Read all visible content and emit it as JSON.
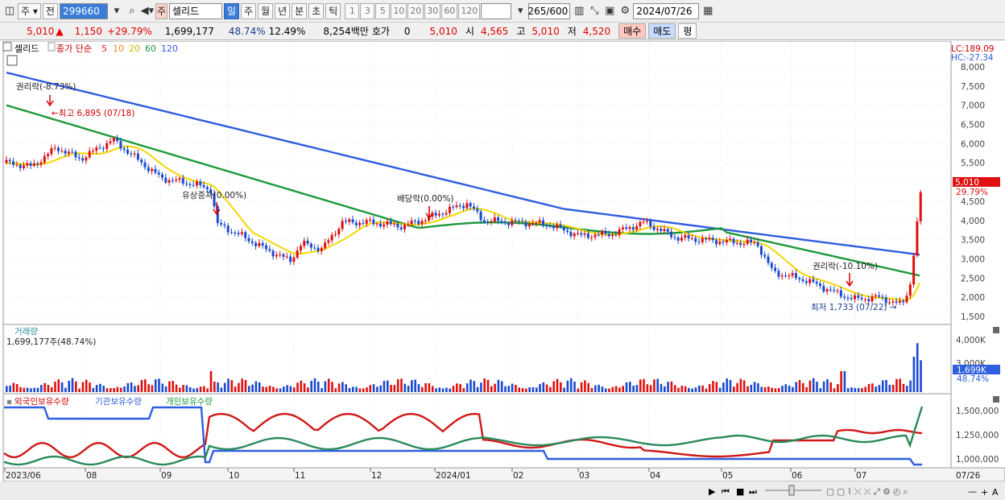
{
  "toolbar": {
    "type1": "주",
    "type2": "전",
    "code": "299660",
    "kind": "주",
    "name": "셀리드",
    "periods": [
      "일",
      "주",
      "월",
      "년",
      "분",
      "초",
      "틱"
    ],
    "selected_period": "일",
    "ticks": [
      "1",
      "3",
      "5",
      "10",
      "20",
      "30",
      "60",
      "120"
    ],
    "count": "265",
    "count_max": "/600",
    "date": "2024/07/26"
  },
  "quote": {
    "price": "5,010",
    "arrow": "▲",
    "change": "1,150",
    "rate": "+29.79%",
    "volume": "1,699,177",
    "vol_ratio": "48.74%",
    "turnover": "12.49%",
    "amount": "8,254백만",
    "hoga_label": "호가",
    "hoga_value": "0",
    "hoga_price": "5,010",
    "open_label": "시",
    "open": "4,565",
    "high_label": "고",
    "high": "5,010",
    "low_label": "저",
    "low": "4,520",
    "buy": "매수",
    "sell": "매도",
    "eval": "평"
  },
  "legend": {
    "name": "셀리드",
    "ma_label": "종가 단순",
    "ma": [
      "5",
      "10",
      "20",
      "60",
      "120"
    ],
    "lc": "LC:189.09",
    "hc": "HC:-27.34"
  },
  "ma_colors": {
    "5": "#e02020",
    "10": "#f08a24",
    "20": "#f5d800",
    "60": "#1e9a3a",
    "120": "#2f5ee0"
  },
  "price_axis": [
    "8,000",
    "7,500",
    "7,000",
    "6,500",
    "6,000",
    "5,500",
    "5,000",
    "4,500",
    "4,000",
    "3,500",
    "3,000",
    "2,500",
    "2,000",
    "1,500"
  ],
  "current_price_tag": "5,010",
  "current_rate_tag": "29.79%",
  "annotations": {
    "ex_rights1": "권리락(-8.73%)",
    "high": "←최고 6,895 (07/18)",
    "rights_issue": "유상증자(0.00%)",
    "dividend": "배당락(0.00%)",
    "ex_rights2": "권리락(-10.10%)",
    "low": "최저 1,733 (07/22) →"
  },
  "volume": {
    "title": "거래량",
    "value": "1,699,177주(48.74%)",
    "axis": [
      "4,000K",
      "3,000K"
    ],
    "tag": "1,699K",
    "tag_rate": "48.74%"
  },
  "holdings": {
    "items": [
      "외국인보유수량",
      "기관보유수량",
      "개인보유수량"
    ],
    "axis": [
      "1,500,000",
      "1,250,000",
      "1,000,000"
    ]
  },
  "date_axis": [
    "2023/06",
    "08",
    "09",
    "10",
    "11",
    "12",
    "2024/01",
    "02",
    "03",
    "04",
    "05",
    "06",
    "07"
  ],
  "date_end": "07/26"
}
